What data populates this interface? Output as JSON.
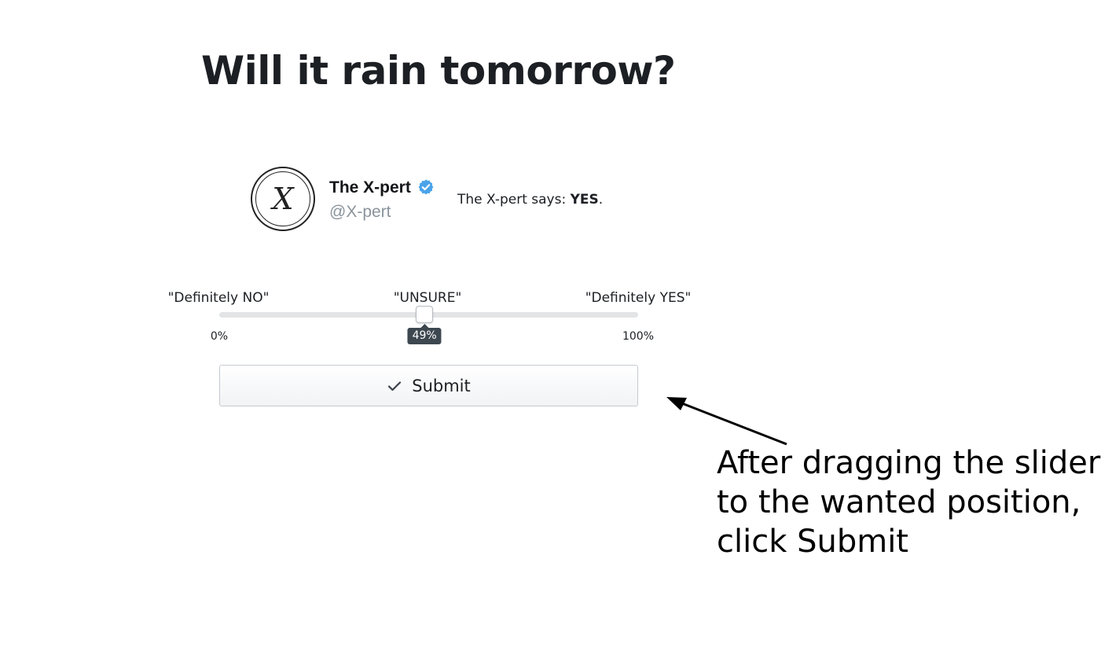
{
  "question": {
    "title": "Will it rain tomorrow?"
  },
  "expert": {
    "avatar_glyph": "X",
    "name": "The X-pert",
    "handle": "@X-pert",
    "verified_icon": "verified-badge-icon",
    "verified_color": "#4aa3ea",
    "statement_prefix": "The X-pert says: ",
    "statement_answer": "YES",
    "statement_suffix": "."
  },
  "slider": {
    "labels": {
      "left": "\"Definitely NO\"",
      "center": "\"UNSURE\"",
      "right": "\"Definitely YES\""
    },
    "min_label": "0%",
    "max_label": "100%",
    "value": 49,
    "value_label": "49%"
  },
  "submit": {
    "icon": "check-icon",
    "label": "Submit"
  },
  "annotation": {
    "lines": [
      "After dragging the slider",
      "to the wanted position,",
      "click Submit"
    ]
  }
}
